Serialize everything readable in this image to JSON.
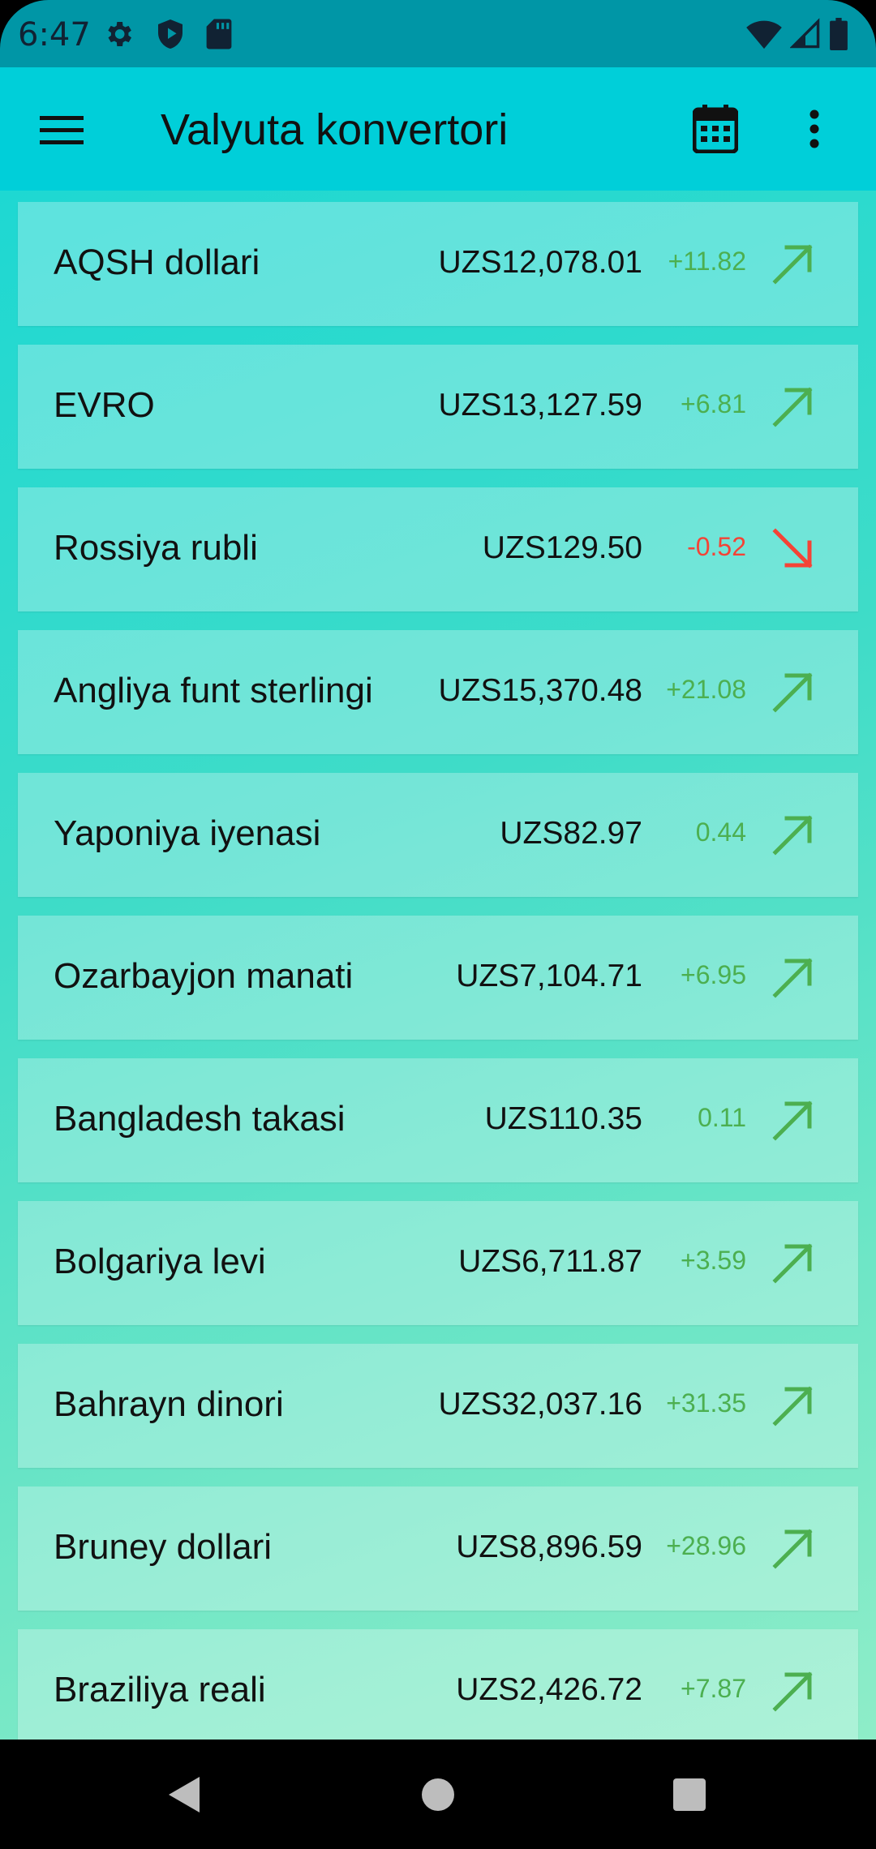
{
  "status_bar": {
    "time": "6:47",
    "left_icons": [
      "gear-icon",
      "shield-play-icon",
      "sd-card-icon"
    ],
    "right_icons": [
      "wifi-icon",
      "cell-signal-icon",
      "battery-icon"
    ]
  },
  "app_bar": {
    "title": "Valyuta konvertori",
    "menu_icon": "hamburger-menu-icon",
    "calendar_icon": "calendar-icon",
    "overflow_icon": "more-vert-icon"
  },
  "colors": {
    "status_bar": "#0096a6",
    "app_bar": "#00cfd9",
    "gradient_start": "#1ed8d2",
    "gradient_end": "#8eedc8",
    "up": "#4caf50",
    "down": "#f44336"
  },
  "currencies": [
    {
      "name": "AQSH dollari",
      "value": "UZS12,078.01",
      "change": "+11.82",
      "trend": "up"
    },
    {
      "name": "EVRO",
      "value": "UZS13,127.59",
      "change": "+6.81",
      "trend": "up"
    },
    {
      "name": "Rossiya rubli",
      "value": "UZS129.50",
      "change": "-0.52",
      "trend": "down"
    },
    {
      "name": "Angliya funt sterlingi",
      "value": "UZS15,370.48",
      "change": "+21.08",
      "trend": "up"
    },
    {
      "name": "Yaponiya iyenasi",
      "value": "UZS82.97",
      "change": "0.44",
      "trend": "up"
    },
    {
      "name": "Ozarbayjon manati",
      "value": "UZS7,104.71",
      "change": "+6.95",
      "trend": "up"
    },
    {
      "name": "Bangladesh takasi",
      "value": "UZS110.35",
      "change": "0.11",
      "trend": "up"
    },
    {
      "name": "Bolgariya levi",
      "value": "UZS6,711.87",
      "change": "+3.59",
      "trend": "up"
    },
    {
      "name": "Bahrayn dinori",
      "value": "UZS32,037.16",
      "change": "+31.35",
      "trend": "up"
    },
    {
      "name": "Bruney dollari",
      "value": "UZS8,896.59",
      "change": "+28.96",
      "trend": "up"
    },
    {
      "name": "Braziliya reali",
      "value": "UZS2,426.72",
      "change": "+7.87",
      "trend": "up"
    }
  ],
  "nav_bar": {
    "back_icon": "back-triangle-icon",
    "home_icon": "home-circle-icon",
    "recents_icon": "recents-square-icon"
  }
}
